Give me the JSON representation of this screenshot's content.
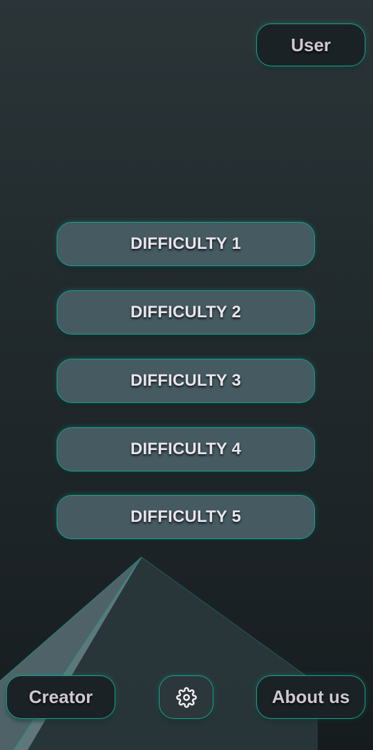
{
  "header": {
    "user_label": "User"
  },
  "difficulties": [
    {
      "label": "DIFFICULTY 1"
    },
    {
      "label": "DIFFICULTY 2"
    },
    {
      "label": "DIFFICULTY 3"
    },
    {
      "label": "DIFFICULTY 4"
    },
    {
      "label": "DIFFICULTY 5"
    }
  ],
  "footer": {
    "creator_label": "Creator",
    "settings_icon": "gear-icon",
    "about_label": "About us"
  },
  "colors": {
    "accent": "#1e9e8c",
    "button_fill": "#455a61",
    "dark_button_fill": "#1b2225",
    "background": "#1d2427",
    "text": "#e9e5ec"
  }
}
